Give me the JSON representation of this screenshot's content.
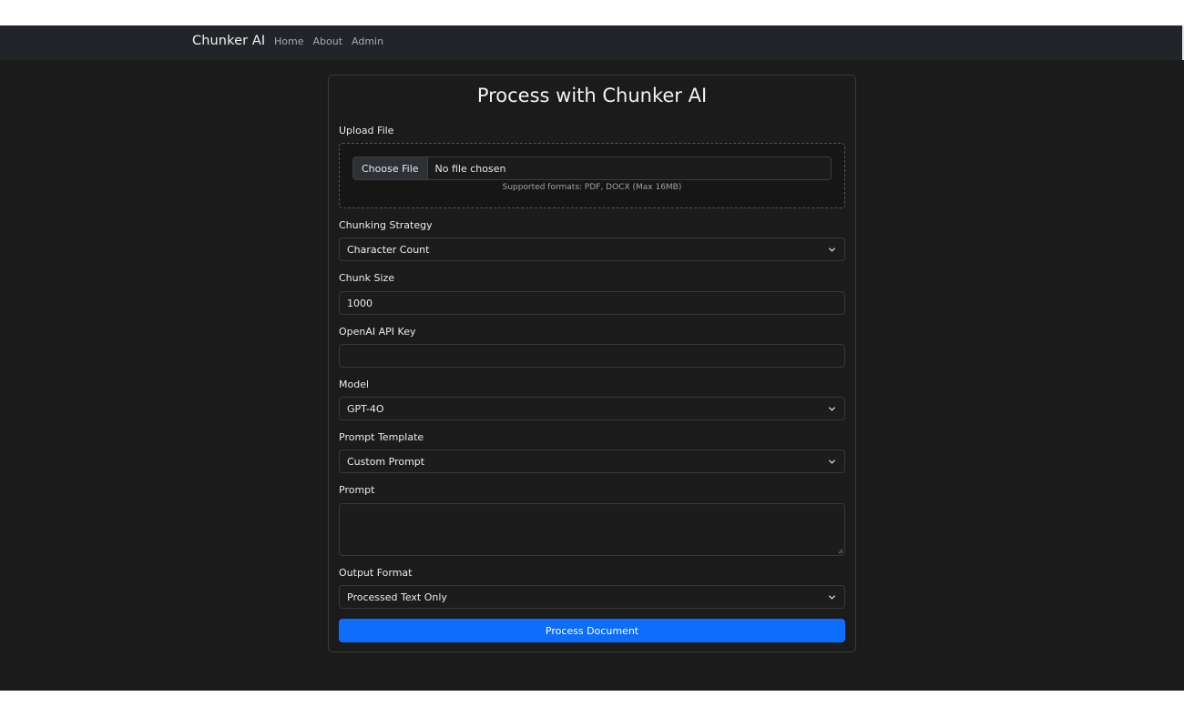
{
  "nav": {
    "brand": "Chunker AI",
    "links": [
      "Home",
      "About",
      "Admin"
    ]
  },
  "form": {
    "title": "Process with Chunker AI",
    "upload": {
      "label": "Upload File",
      "button": "Choose File",
      "status": "No file chosen",
      "hint": "Supported formats: PDF, DOCX (Max 16MB)"
    },
    "chunking_strategy": {
      "label": "Chunking Strategy",
      "value": "Character Count"
    },
    "chunk_size": {
      "label": "Chunk Size",
      "value": "1000"
    },
    "api_key": {
      "label": "OpenAI API Key",
      "value": ""
    },
    "model": {
      "label": "Model",
      "value": "GPT-4O"
    },
    "prompt_template": {
      "label": "Prompt Template",
      "value": "Custom Prompt"
    },
    "prompt": {
      "label": "Prompt",
      "value": ""
    },
    "output_format": {
      "label": "Output Format",
      "value": "Processed Text Only"
    },
    "submit": "Process Document"
  },
  "colors": {
    "background": "#1b1b1b",
    "navbar": "#212428",
    "accent": "#0d6efd"
  },
  "icons": {
    "select_chevron": "chevron-down-icon",
    "textarea_resize": "resize-handle-icon"
  }
}
